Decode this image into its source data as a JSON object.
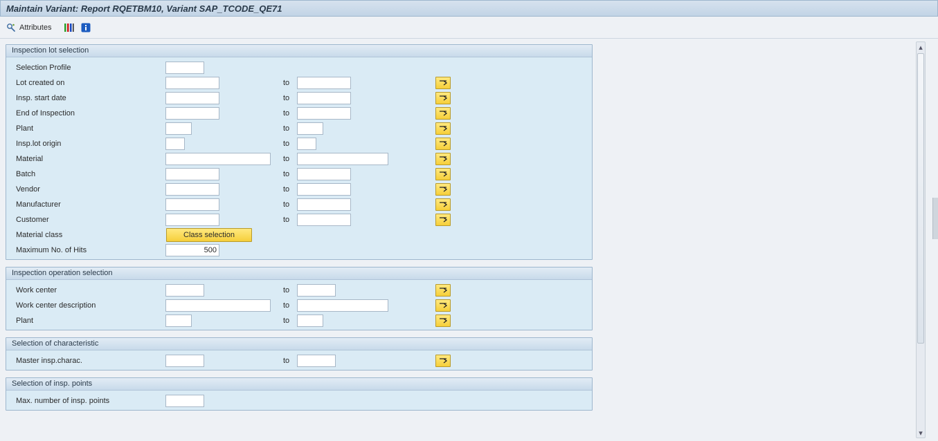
{
  "title": "Maintain Variant: Report RQETBM10, Variant SAP_TCODE_QE71",
  "toolbar": {
    "attributes_label": "Attributes"
  },
  "to_label": "to",
  "groups": {
    "g1_title": "Inspection lot selection",
    "g2_title": "Inspection operation selection",
    "g3_title": "Selection of characteristic",
    "g4_title": "Selection of insp. points"
  },
  "g1": {
    "selection_profile": "Selection Profile",
    "lot_created_on": "Lot created on",
    "insp_start_date": "Insp. start date",
    "end_of_inspection": "End of Inspection",
    "plant": "Plant",
    "insp_lot_origin": "Insp.lot origin",
    "material": "Material",
    "batch": "Batch",
    "vendor": "Vendor",
    "manufacturer": "Manufacturer",
    "customer": "Customer",
    "material_class": "Material class",
    "class_selection_btn": "Class selection",
    "max_hits_label": "Maximum No. of Hits",
    "max_hits_value": "500"
  },
  "g2": {
    "work_center": "Work center",
    "work_center_desc": "Work center description",
    "plant": "Plant"
  },
  "g3": {
    "master_insp_charac": "Master insp.charac."
  },
  "g4": {
    "max_insp_points": "Max. number of insp. points"
  }
}
